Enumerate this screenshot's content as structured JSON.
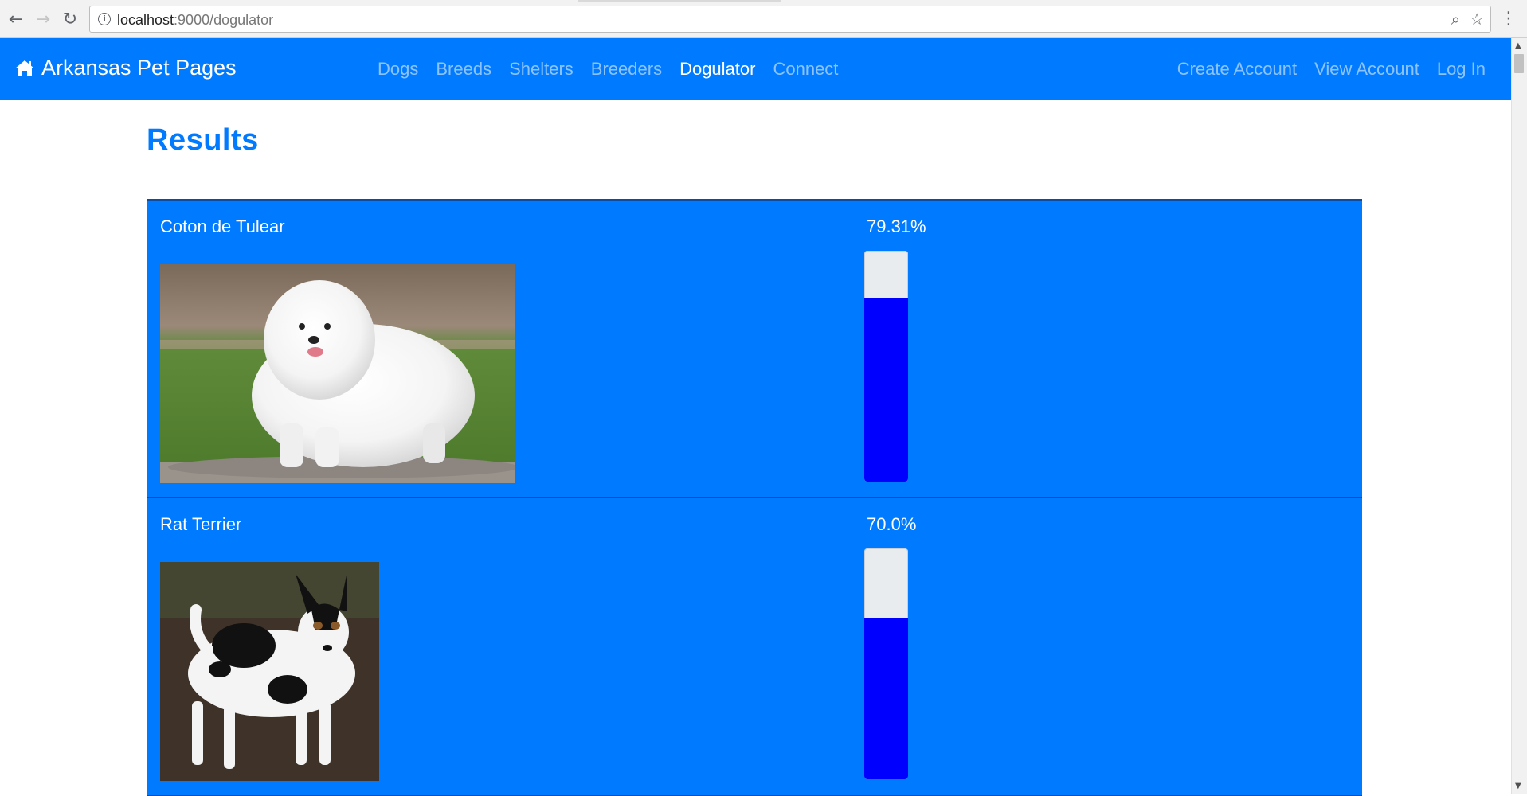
{
  "browser": {
    "url_host": "localhost",
    "url_path": ":9000/dogulator",
    "back_icon": "arrow-left-icon",
    "forward_icon": "arrow-right-icon",
    "reload_icon": "reload-icon"
  },
  "navbar": {
    "brand": "Arkansas Pet Pages",
    "brand_icon": "home-icon",
    "links": [
      {
        "label": "Dogs",
        "active": false
      },
      {
        "label": "Breeds",
        "active": false
      },
      {
        "label": "Shelters",
        "active": false
      },
      {
        "label": "Breeders",
        "active": false
      },
      {
        "label": "Dogulator",
        "active": true
      },
      {
        "label": "Connect",
        "active": false
      }
    ],
    "right_links": [
      {
        "label": "Create Account"
      },
      {
        "label": "View Account"
      },
      {
        "label": "Log In"
      }
    ],
    "bg_color": "#007bff"
  },
  "page": {
    "title": "Results"
  },
  "results": [
    {
      "breed": "Coton de Tulear",
      "percent_label": "79.31%",
      "percent": 79.31,
      "photo": "white fluffy dog on grass"
    },
    {
      "breed": "Rat Terrier",
      "percent_label": "70.0%",
      "percent": 70.0,
      "photo": "black and white terrier on dirt"
    }
  ],
  "colors": {
    "row_bg": "#007bff",
    "bar_fill": "#0000ff",
    "bar_track": "#e9ecef"
  }
}
